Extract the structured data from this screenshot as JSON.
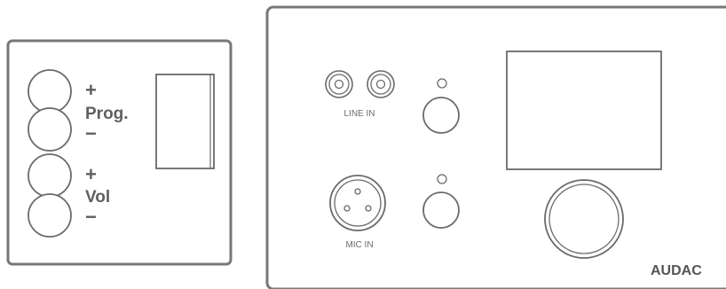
{
  "left_panel": {
    "prog_plus": "+",
    "prog_label": "Prog.",
    "prog_minus": "−",
    "vol_plus": "+",
    "vol_label": "Vol",
    "vol_minus": "−"
  },
  "right_panel": {
    "line_in_label": "LINE IN",
    "mic_in_label": "MIC IN",
    "brand_label": "AUDAC"
  },
  "colors": {
    "outline": "#777777",
    "text": "#5f5f5f"
  }
}
